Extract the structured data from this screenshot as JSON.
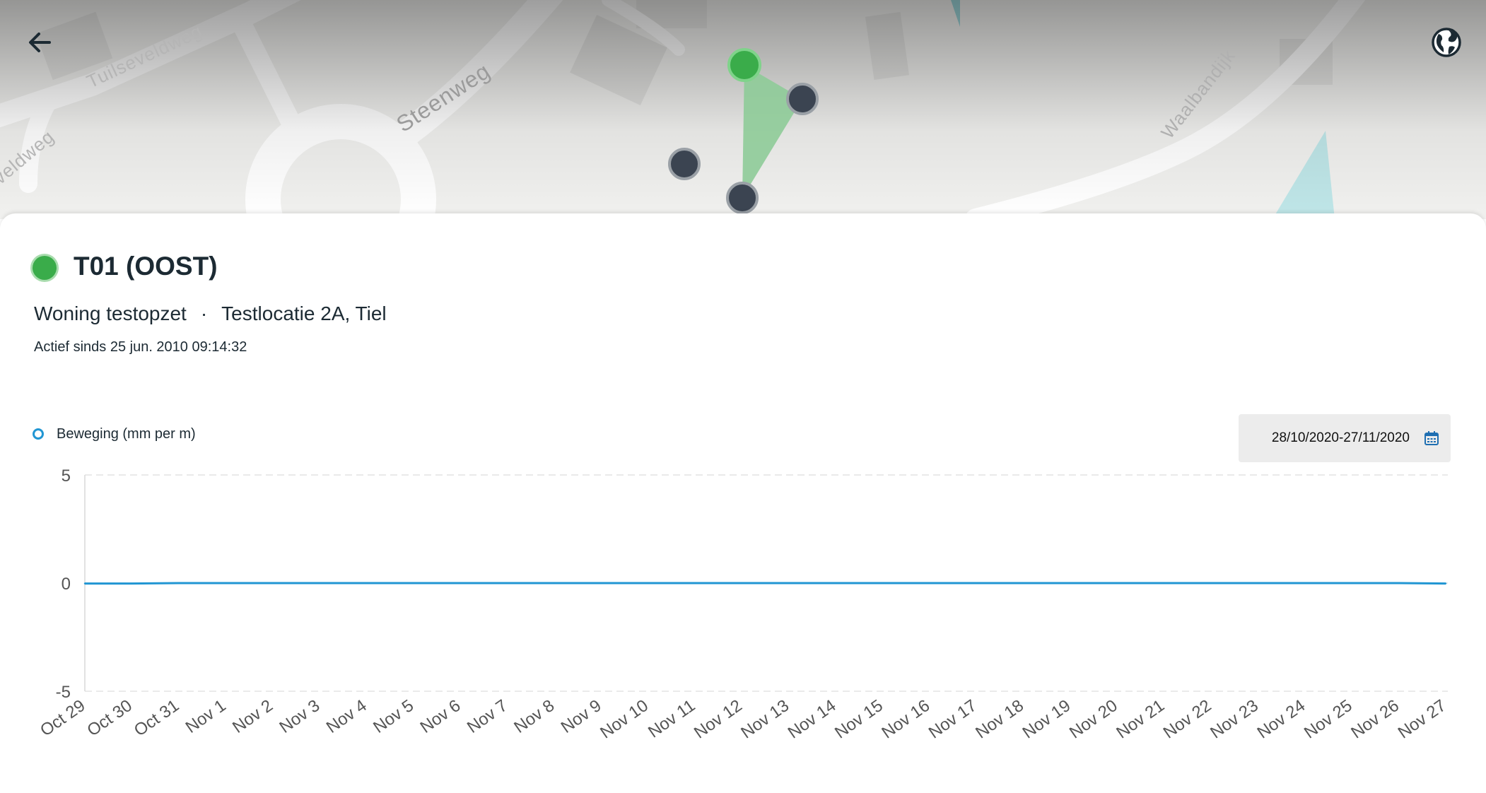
{
  "map": {
    "street_labels": [
      "Tuilseveldweg",
      "Steenweg",
      "Waalbandijk",
      "veldweg"
    ],
    "back_icon": "arrow-left-icon",
    "layers_icon": "globe-icon",
    "active_sensor_color": "#3aac4a",
    "inactive_sensor_color": "#3b4451",
    "triangle_color": "#8ecb98"
  },
  "sensor": {
    "status": "active",
    "status_color": "#3aac4a",
    "title": "T01 (OOST)",
    "project": "Woning testopzet",
    "separator": "·",
    "location": "Testlocatie 2A, Tiel",
    "active_since": "Actief sinds 25 jun. 2010 09:14:32"
  },
  "chart_controls": {
    "legend_label": "Beweging (mm per m)",
    "legend_color": "#2196d3",
    "date_range": "28/10/2020-27/11/2020",
    "calendar_icon": "calendar-icon"
  },
  "chart_data": {
    "type": "line",
    "x": [
      "Oct 29",
      "Oct 30",
      "Oct 31",
      "Nov 1",
      "Nov 2",
      "Nov 3",
      "Nov 4",
      "Nov 5",
      "Nov 6",
      "Nov 7",
      "Nov 8",
      "Nov 9",
      "Nov 10",
      "Nov 11",
      "Nov 12",
      "Nov 13",
      "Nov 14",
      "Nov 15",
      "Nov 16",
      "Nov 17",
      "Nov 18",
      "Nov 19",
      "Nov 20",
      "Nov 21",
      "Nov 22",
      "Nov 23",
      "Nov 24",
      "Nov 25",
      "Nov 26",
      "Nov 27"
    ],
    "series": [
      {
        "name": "Beweging (mm per m)",
        "color": "#2196d3",
        "values": [
          -0.02,
          -0.02,
          0,
          0,
          0,
          0,
          0,
          0,
          0,
          0,
          0,
          0,
          0,
          0,
          0,
          0,
          0,
          0,
          0,
          0,
          0,
          0,
          0,
          0,
          0,
          0,
          0,
          0,
          0,
          -0.02
        ]
      }
    ],
    "yticks": [
      "5",
      "0",
      "-5"
    ],
    "ylim": [
      -5,
      5
    ],
    "grid": true,
    "legend_position": "top-left"
  }
}
